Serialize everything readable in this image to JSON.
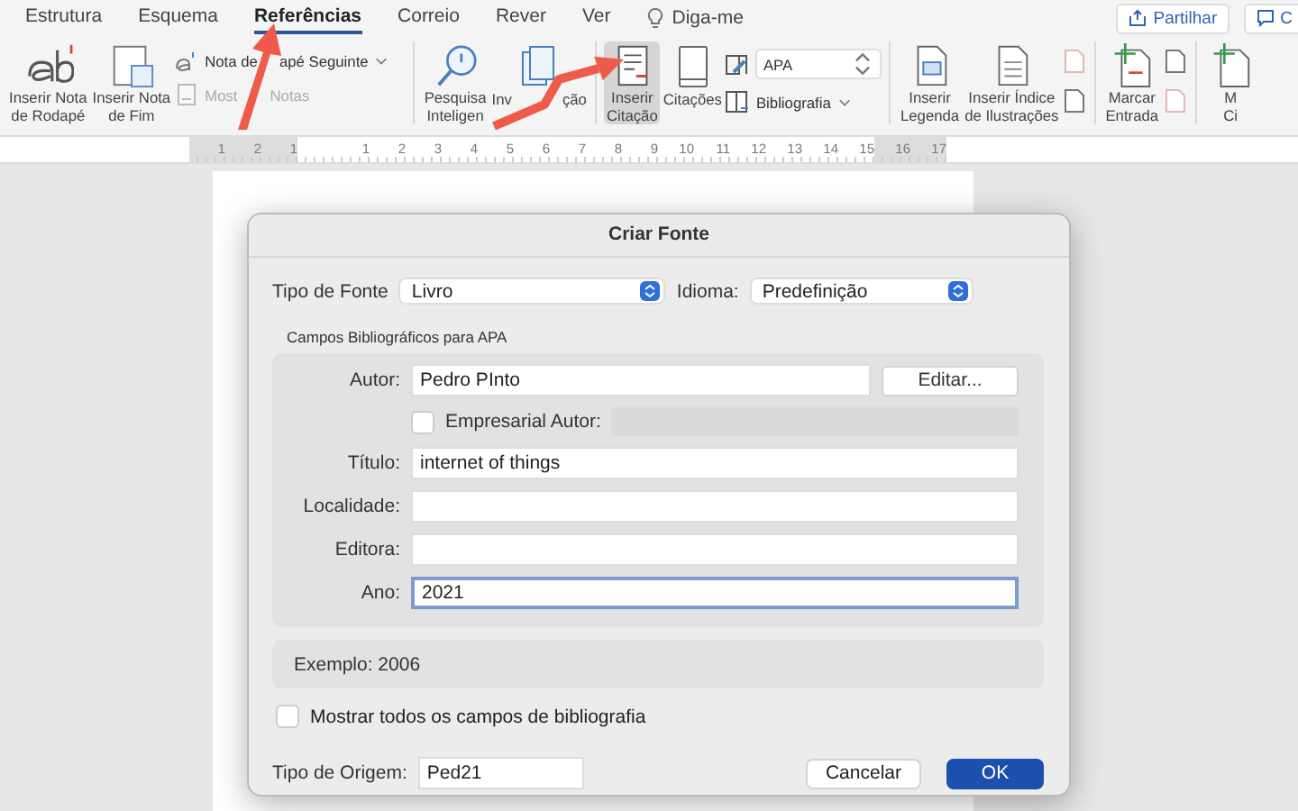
{
  "tabs": [
    {
      "label": "Estrutura",
      "selected": false
    },
    {
      "label": "Esquema",
      "selected": false
    },
    {
      "label": "Referências",
      "selected": true
    },
    {
      "label": "Correio",
      "selected": false
    },
    {
      "label": "Rever",
      "selected": false
    },
    {
      "label": "Ver",
      "selected": false
    }
  ],
  "tell_me": "Diga-me",
  "share_button": "Partilhar",
  "comments_button": "C",
  "ribbon": [
    {
      "items": [
        {
          "kind": "large",
          "lines": [
            "Inserir Nota",
            "de Rodapé"
          ]
        },
        {
          "kind": "large",
          "lines": [
            "Inserir Nota",
            "de Fim"
          ]
        },
        {
          "kind": "stack",
          "entries": [
            {
              "kind": "menu",
              "parts": [
                "Nota de",
                "apé Seguinte"
              ],
              "disabled": false
            },
            {
              "kind": "plain",
              "parts": [
                "Most",
                "Notas"
              ],
              "disabled": true
            }
          ]
        }
      ]
    },
    {
      "items": [
        {
          "kind": "large",
          "lines": [
            "Pesquisa",
            "Inteligen"
          ]
        },
        {
          "kind": "large",
          "lines": [
            [
              "Inv",
              "ção"
            ]
          ]
        }
      ]
    },
    {
      "items": [
        {
          "kind": "large",
          "lines": [
            "Inserir",
            "Citação"
          ],
          "pressed": true
        },
        {
          "kind": "large",
          "lines": [
            "Citações"
          ],
          "pressed": false
        },
        {
          "kind": "stack",
          "entries": [
            {
              "kind": "select",
              "parts": [
                "APA"
              ]
            },
            {
              "kind": "menu",
              "parts": [
                "Bibliografia"
              ],
              "disabled": false
            }
          ]
        }
      ]
    },
    {
      "items": [
        {
          "kind": "large",
          "lines": [
            "Inserir",
            "Legenda"
          ]
        },
        {
          "kind": "large",
          "lines": [
            "Inserir Índice",
            "de Ilustrações"
          ]
        },
        {
          "kind": "icons",
          "entries": [
            {
              "disabled": true
            },
            {
              "disabled": false
            }
          ]
        }
      ]
    },
    {
      "items": [
        {
          "kind": "large",
          "lines": [
            "Marcar",
            "Entrada"
          ]
        },
        {
          "kind": "icons",
          "entries": [
            {
              "disabled": false
            },
            {
              "disabled": true
            }
          ]
        }
      ]
    },
    {
      "items": [
        {
          "kind": "large",
          "lines": [
            "M",
            "Ci"
          ]
        }
      ]
    }
  ],
  "ruler": {
    "left_marks": [
      "1",
      "2",
      "1"
    ],
    "marks": [
      "1",
      "2",
      "3",
      "4",
      "5",
      "6",
      "7",
      "8",
      "9",
      "10",
      "11",
      "12",
      "13",
      "14",
      "15",
      "16",
      "17"
    ]
  },
  "dialog": {
    "title": "Criar Fonte",
    "source_type": {
      "label": "Tipo de Fonte",
      "value": "Livro"
    },
    "language": {
      "label": "Idioma:",
      "value": "Predefinição"
    },
    "group_title": "Campos Bibliográficos para APA",
    "fields": [
      {
        "kind": "text",
        "label": "Autor:",
        "value": "Pedro PInto",
        "button": "Editar...",
        "focused": false
      },
      {
        "kind": "checkbox",
        "label": "Empresarial Autor:",
        "checked": false
      },
      {
        "kind": "text",
        "label": "Título:",
        "value": "internet of things",
        "focused": false
      },
      {
        "kind": "text",
        "label": "Localidade:",
        "focused": false
      },
      {
        "kind": "text",
        "label": "Editora:",
        "focused": false
      },
      {
        "kind": "text",
        "label": "Ano:",
        "value": "2021",
        "focused": true
      }
    ],
    "example": "Exemplo: 2006",
    "show_all": {
      "label": "Mostrar todos os campos de bibliografia",
      "checked": false
    },
    "tag": {
      "label": "Tipo de Origem:",
      "value": "Ped21"
    },
    "buttons": [
      {
        "label": "Cancelar",
        "kind": "secondary"
      },
      {
        "label": "OK",
        "kind": "primary"
      }
    ]
  }
}
